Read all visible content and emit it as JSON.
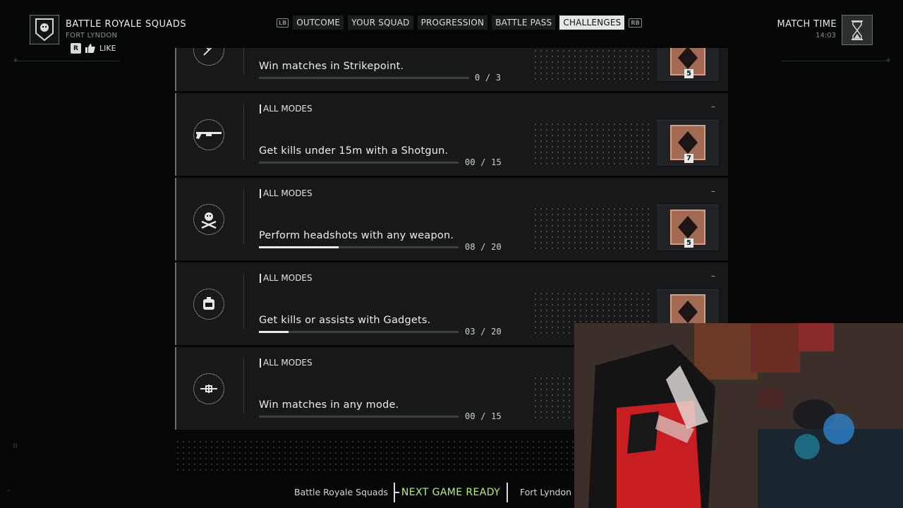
{
  "header": {
    "mode_title": "BATTLE ROYALE SQUADS",
    "map_name": "FORT LYNDON",
    "like_key": "R",
    "like_label": "LIKE",
    "left_bumper": "LB",
    "right_bumper": "RB",
    "tabs": [
      {
        "label": "OUTCOME",
        "active": false
      },
      {
        "label": "YOUR SQUAD",
        "active": false
      },
      {
        "label": "PROGRESSION",
        "active": false
      },
      {
        "label": "BATTLE PASS",
        "active": false
      },
      {
        "label": "CHALLENGES",
        "active": true
      }
    ],
    "match_time_label": "MATCH TIME",
    "match_time_value": "14:03"
  },
  "challenges": [
    {
      "mode": "",
      "description": "Win matches in Strikepoint.",
      "progress_text": "0 / 3",
      "progress": 0.0,
      "reward": "5",
      "dash": ""
    },
    {
      "mode": "ALL MODES",
      "description": "Get kills under 15m with a Shotgun.",
      "progress_text": "00 / 15",
      "progress": 0.0,
      "reward": "7",
      "dash": "–"
    },
    {
      "mode": "ALL MODES",
      "description": "Perform headshots with any weapon.",
      "progress_text": "08 / 20",
      "progress": 0.4,
      "reward": "5",
      "dash": "–"
    },
    {
      "mode": "ALL MODES",
      "description": "Get kills or assists with Gadgets.",
      "progress_text": "03 / 20",
      "progress": 0.15,
      "reward": "",
      "dash": "–"
    },
    {
      "mode": "ALL MODES",
      "description": "Win matches in any mode.",
      "progress_text": "00 / 15",
      "progress": 0.0,
      "reward": "",
      "dash": ""
    }
  ],
  "footer": {
    "mode": "Battle Royale Squads",
    "status": "NEXT GAME READY",
    "map": "Fort Lyndon"
  },
  "colors": {
    "ready_text": "#b8f07a",
    "reward_copper": "#a26a52",
    "card_bg": "#161819"
  },
  "icons": [
    "squad-emblem-icon",
    "hourglass-icon",
    "thumbs-up-icon",
    "target-icon",
    "shotgun-icon",
    "skull-crossbones-icon",
    "gadget-icon",
    "crosshair-icon",
    "reward-frame-icon"
  ]
}
